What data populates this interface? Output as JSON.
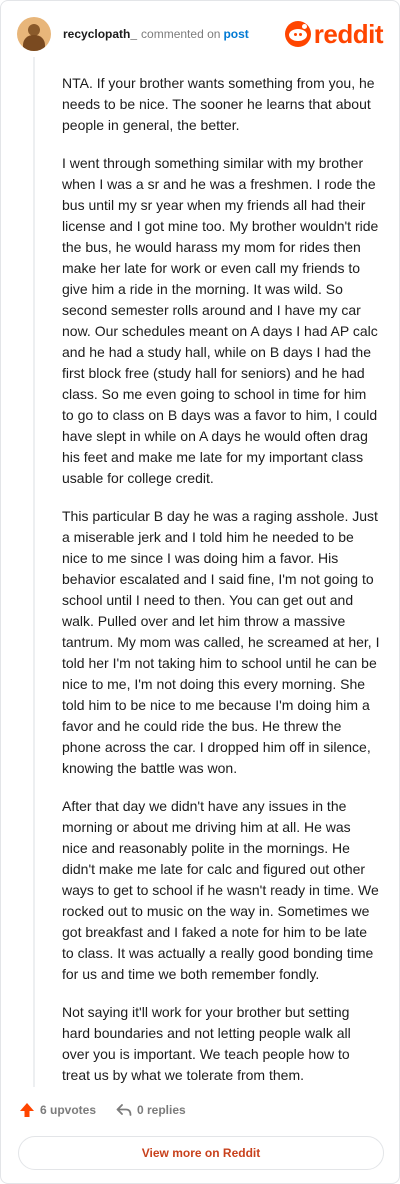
{
  "header": {
    "username": "recyclopath_",
    "commented_on": "commented on",
    "post_link": "post",
    "logo_text": "reddit"
  },
  "comment": {
    "paragraphs": [
      "NTA. If your brother wants something from you, he needs to be nice. The sooner he learns that about people in general, the better.",
      "I went through something similar with my brother when I was a sr and he was a freshmen. I rode the bus until my sr year when my friends all had their license and I got mine too. My brother wouldn't ride the bus, he would harass my mom for rides then make her late for work or even call my friends to give him a ride in the morning. It was wild. So second semester rolls around and I have my car now. Our schedules meant on A days I had AP calc and he had a study hall, while on B days I had the first block free (study hall for seniors) and he had class. So me even going to school in time for him to go to class on B days was a favor to him, I could have slept in while on A days he would often drag his feet and make me late for my important class usable for college credit.",
      "This particular B day he was a raging asshole. Just a miserable jerk and I told him he needed to be nice to me since I was doing him a favor. His behavior escalated and I said fine, I'm not going to school until I need to then. You can get out and walk. Pulled over and let him throw a massive tantrum. My mom was called, he screamed at her, I told her I'm not taking him to school until he can be nice to me, I'm not doing this every morning. She told him to be nice to me because I'm doing him a favor and he could ride the bus. He threw the phone across the car. I dropped him off in silence, knowing the battle was won.",
      "After that day we didn't have any issues in the morning or about me driving him at all. He was nice and reasonably polite in the mornings. He didn't make me late for calc and figured out other ways to get to school if he wasn't ready in time. We rocked out to music on the way in. Sometimes we got breakfast and I faked a note for him to be late to class. It was actually a really good bonding time for us and time we both remember fondly.",
      "Not saying it'll work for your brother but setting hard boundaries and not letting people walk all over you is important. We teach people how to treat us by what we tolerate from them."
    ]
  },
  "actions": {
    "upvotes": "6 upvotes",
    "replies": "0 replies"
  },
  "footer": {
    "view_more": "View more on Reddit"
  },
  "colors": {
    "brand": "#ff4500",
    "link": "#0079d3",
    "view_more_text": "#c8411c"
  }
}
